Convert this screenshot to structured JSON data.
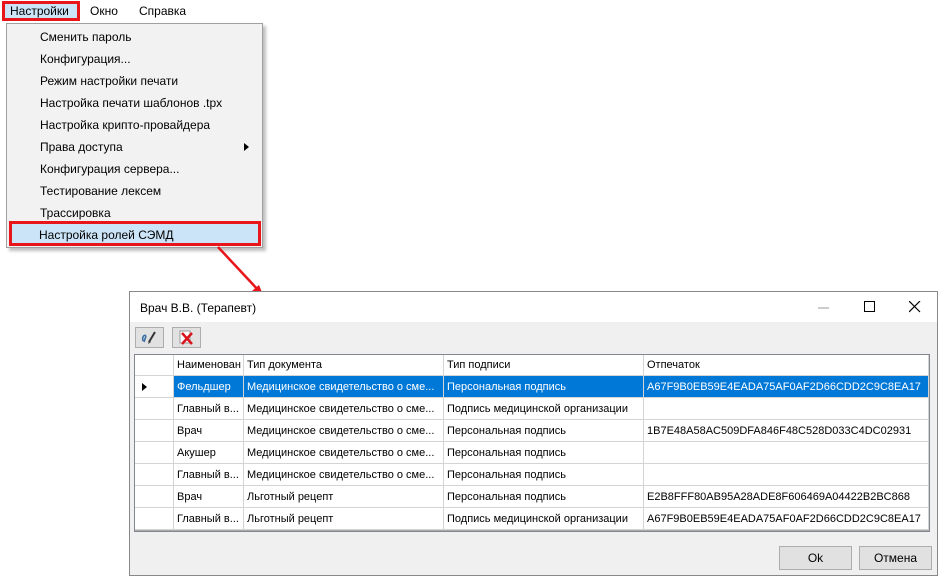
{
  "menubar": {
    "items": [
      {
        "label": "Настройки"
      },
      {
        "label": "Окно"
      },
      {
        "label": "Справка"
      }
    ]
  },
  "dropdown": {
    "items": [
      {
        "label": "Сменить пароль"
      },
      {
        "label": "Конфигурация..."
      },
      {
        "label": "Режим настройки печати"
      },
      {
        "label": "Настройка печати шаблонов .tpx"
      },
      {
        "label": "Настройка крипто-провайдера"
      },
      {
        "label": "Права доступа"
      },
      {
        "label": "Конфигурация сервера..."
      },
      {
        "label": "Тестирование лексем"
      },
      {
        "label": "Трассировка"
      },
      {
        "label": "Настройка ролей СЭМД"
      }
    ]
  },
  "dialog": {
    "title": "Врач В.В. (Терапевт)",
    "columns": [
      "Наименован",
      "Тип документа",
      "Тип подписи",
      "Отпечаток"
    ],
    "rows": [
      {
        "name": "Фельдшер",
        "doc": "Медицинское свидетельство о сме...",
        "sign": "Персональная подпись",
        "print": "A67F9B0EB59E4EADA75AF0AF2D66CDD2C9C8EA17"
      },
      {
        "name": "Главный в...",
        "doc": "Медицинское свидетельство о сме...",
        "sign": "Подпись медицинской организации",
        "print": ""
      },
      {
        "name": "Врач",
        "doc": "Медицинское свидетельство о сме...",
        "sign": "Персональная подпись",
        "print": "1B7E48A58AC509DFA846F48C528D033C4DC02931"
      },
      {
        "name": "Акушер",
        "doc": "Медицинское свидетельство о сме...",
        "sign": "Персональная подпись",
        "print": ""
      },
      {
        "name": "Главный в...",
        "doc": "Медицинское свидетельство о сме...",
        "sign": "Персональная подпись",
        "print": ""
      },
      {
        "name": "Врач",
        "doc": "Льготный рецепт",
        "sign": "Персональная подпись",
        "print": "E2B8FFF80AB95A28ADE8F606469A04422B2BC868"
      },
      {
        "name": "Главный в...",
        "doc": "Льготный рецепт",
        "sign": "Подпись медицинской организации",
        "print": "A67F9B0EB59E4EADA75AF0AF2D66CDD2C9C8EA17"
      }
    ],
    "ok_label": "Ok",
    "cancel_label": "Отмена"
  },
  "colors": {
    "highlight": "#e8151b",
    "selection": "#0078d7",
    "menu_hover": "#cce4f7"
  },
  "icons": [
    "edit-pencil-icon",
    "delete-x-icon",
    "minimize-icon",
    "maximize-icon",
    "close-icon",
    "submenu-arrow-icon",
    "row-pointer-icon"
  ]
}
